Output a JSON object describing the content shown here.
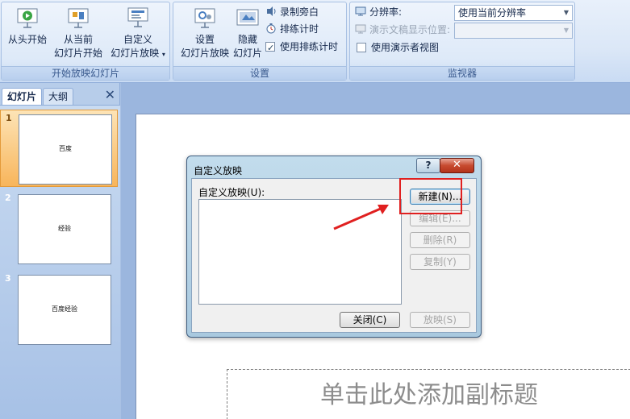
{
  "ribbon": {
    "groups": [
      {
        "label": "开始放映幻灯片"
      },
      {
        "label": "设置"
      },
      {
        "label": "监视器"
      }
    ],
    "start_group": {
      "from_beginning": "从头开始",
      "from_current_line1": "从当前",
      "from_current_line2": "幻灯片开始",
      "custom_line1": "自定义",
      "custom_line2": "幻灯片放映"
    },
    "setup_group": {
      "setup_line1": "设置",
      "setup_line2": "幻灯片放映",
      "hide_line1": "隐藏",
      "hide_line2": "幻灯片",
      "record_narration": "录制旁白",
      "rehearse_timings": "排练计时",
      "use_rehearsed_timings": "使用排练计时"
    },
    "monitors_group": {
      "resolution_label": "分辨率:",
      "resolution_value": "使用当前分辨率",
      "show_on_label": "演示文稿显示位置:",
      "show_on_value": "",
      "presenter_view": "使用演示者视图"
    }
  },
  "left_pane": {
    "tabs": [
      "幻灯片",
      "大纲"
    ],
    "close_glyph": "✕",
    "slides": [
      {
        "number": "1",
        "title": "百度",
        "selected": true
      },
      {
        "number": "2",
        "title": "经验",
        "selected": false
      },
      {
        "number": "3",
        "title": "百度经验",
        "selected": false
      }
    ]
  },
  "slide": {
    "subtitle_placeholder": "单击此处添加副标题"
  },
  "dialog": {
    "title": "自定义放映",
    "help_glyph": "?",
    "close_glyph": "✕",
    "list_label": "自定义放映(U):",
    "buttons": {
      "new": "新建(N)...",
      "edit": "编辑(E)...",
      "delete": "删除(R)",
      "copy": "复制(Y)",
      "close": "关闭(C)",
      "show": "放映(S)"
    }
  },
  "colors": {
    "annotation_red": "#e02020",
    "ribbon_text": "#15284b"
  }
}
